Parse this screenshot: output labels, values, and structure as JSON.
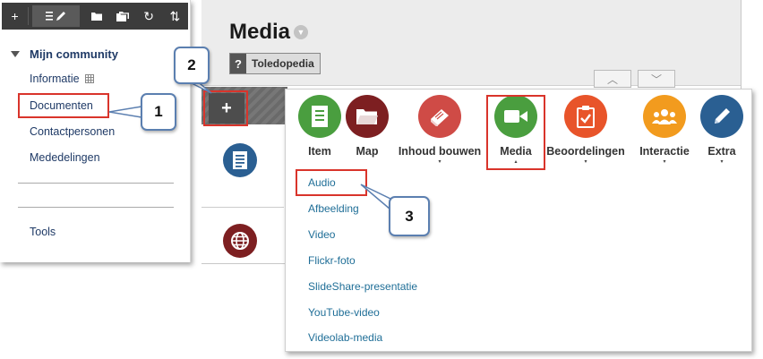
{
  "sidebar": {
    "toolbar": {
      "add_glyph": "+",
      "refresh_glyph": "↻",
      "sort_glyph": "⇅"
    },
    "community_title": "Mijn community",
    "items": [
      {
        "label": "Informatie"
      },
      {
        "label": "Documenten"
      },
      {
        "label": "Contactpersonen"
      },
      {
        "label": "Mededelingen"
      }
    ],
    "tools_label": "Tools"
  },
  "main": {
    "page_title": "Media",
    "badge_icon": "?",
    "badge_label": "Toledopedia",
    "add_glyph": "+",
    "arrow_up_glyph": "︿",
    "arrow_down_glyph": "﹀"
  },
  "popup": {
    "tools": [
      {
        "label": "Item",
        "color": "#4a9e3f",
        "icon": "document-icon",
        "dropdown": false
      },
      {
        "label": "Map",
        "color": "#7d1f21",
        "icon": "folder-icon",
        "dropdown": false
      },
      {
        "label": "Inhoud bouwen",
        "color": "#cf4b46",
        "icon": "book-icon",
        "dropdown": true
      },
      {
        "label": "Media",
        "color": "#4a9e3f",
        "icon": "video-camera-icon",
        "dropdown": true
      },
      {
        "label": "Beoordelingen",
        "color": "#e8542a",
        "icon": "clipboard-check-icon",
        "dropdown": true
      },
      {
        "label": "Interactie",
        "color": "#f29b1e",
        "icon": "group-icon",
        "dropdown": true
      },
      {
        "label": "Extra",
        "color": "#2a5f92",
        "icon": "pencil-icon",
        "dropdown": true
      }
    ],
    "media_items": [
      {
        "label": "Audio"
      },
      {
        "label": "Afbeelding"
      },
      {
        "label": "Video"
      },
      {
        "label": "Flickr-foto"
      },
      {
        "label": "SlideShare-presentatie"
      },
      {
        "label": "YouTube-video"
      },
      {
        "label": "Videolab-media"
      }
    ],
    "dropdown_glyph": "▾"
  },
  "callouts": [
    {
      "label": "1"
    },
    {
      "label": "2"
    },
    {
      "label": "3"
    }
  ],
  "colors": {
    "highlight": "#d9342b",
    "callout_border": "#5b7fb0",
    "link": "#1f6e97",
    "sidebar_text": "#1f3a66"
  }
}
